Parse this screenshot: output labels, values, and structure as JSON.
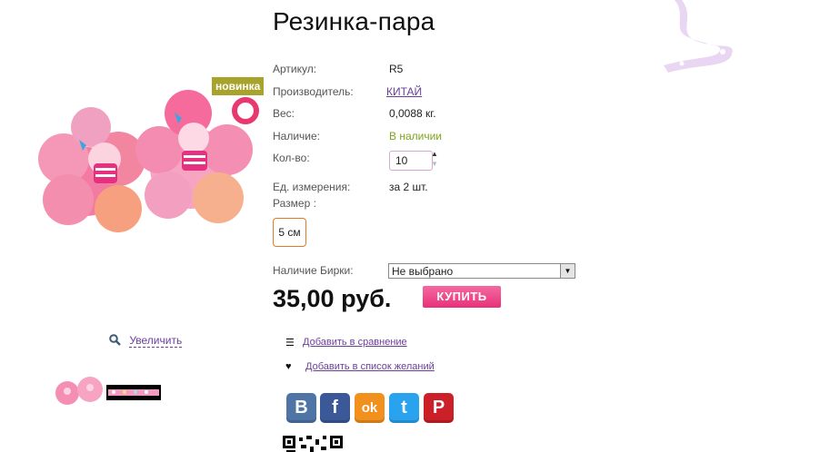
{
  "product": {
    "title": "Резинка-пара",
    "badge": "новинка",
    "zoom_label": "Увеличить"
  },
  "specs": {
    "article_label": "Артикул:",
    "article_value": "R5",
    "maker_label": "Производитель:",
    "maker_value": "КИТАЙ",
    "weight_label": "Вес:",
    "weight_value": "0,0088 кг.",
    "stock_label": "Наличие:",
    "stock_value": "В наличии",
    "qty_label": "Кол-во:",
    "qty_value": "10",
    "unit_label": "Ед. измерения:",
    "unit_value": "за 2 шт.",
    "size_label": "Размер :",
    "size_option": "5 см",
    "tag_label": "Наличие Бирки:",
    "tag_value": "Не выбрано"
  },
  "purchase": {
    "price": "35,00 руб.",
    "buy_label": "КУПИТЬ"
  },
  "actions": {
    "compare_label": "Добавить в сравнение",
    "wishlist_label": "Добавить в список желаний"
  },
  "social": [
    {
      "name": "vk",
      "glyph": "B"
    },
    {
      "name": "facebook",
      "glyph": "f"
    },
    {
      "name": "odnoklassniki",
      "glyph": "ok"
    },
    {
      "name": "twitter",
      "glyph": "t"
    },
    {
      "name": "pinterest",
      "glyph": "P"
    }
  ],
  "colors": {
    "accent_pink": "#e9307a",
    "link_purple": "#6b3e9a",
    "stock_green": "#7ea31f",
    "badge_olive": "#a8a32a",
    "size_border": "#e07b27"
  }
}
